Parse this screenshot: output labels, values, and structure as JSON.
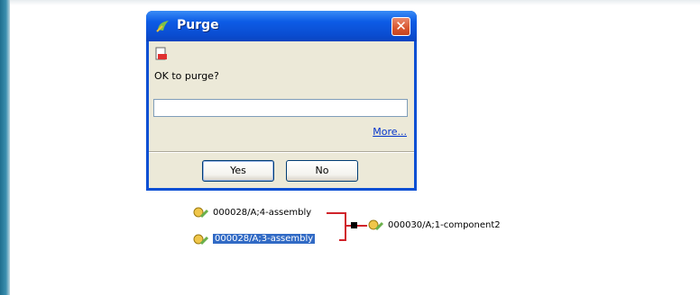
{
  "dialog": {
    "title": "Purge",
    "close_glyph": "✕",
    "prompt": "OK to purge?",
    "input_value": "",
    "more_link": "More...",
    "yes_label": "Yes",
    "no_label": "No"
  },
  "graph": {
    "nodes": [
      {
        "label": "000028/A;4-assembly",
        "selected": false
      },
      {
        "label": "000028/A;3-assembly",
        "selected": true
      },
      {
        "label": "000030/A;1-component2",
        "selected": false
      }
    ]
  },
  "icons": {
    "title": "purge-app-icon",
    "message": "document-icon",
    "node": "part-icon"
  },
  "colors": {
    "titlebar": "#0a4fd3",
    "close": "#d9562f",
    "dialog_bg": "#ece9d8",
    "link": "#d0232a",
    "selection": "#316ac5"
  }
}
